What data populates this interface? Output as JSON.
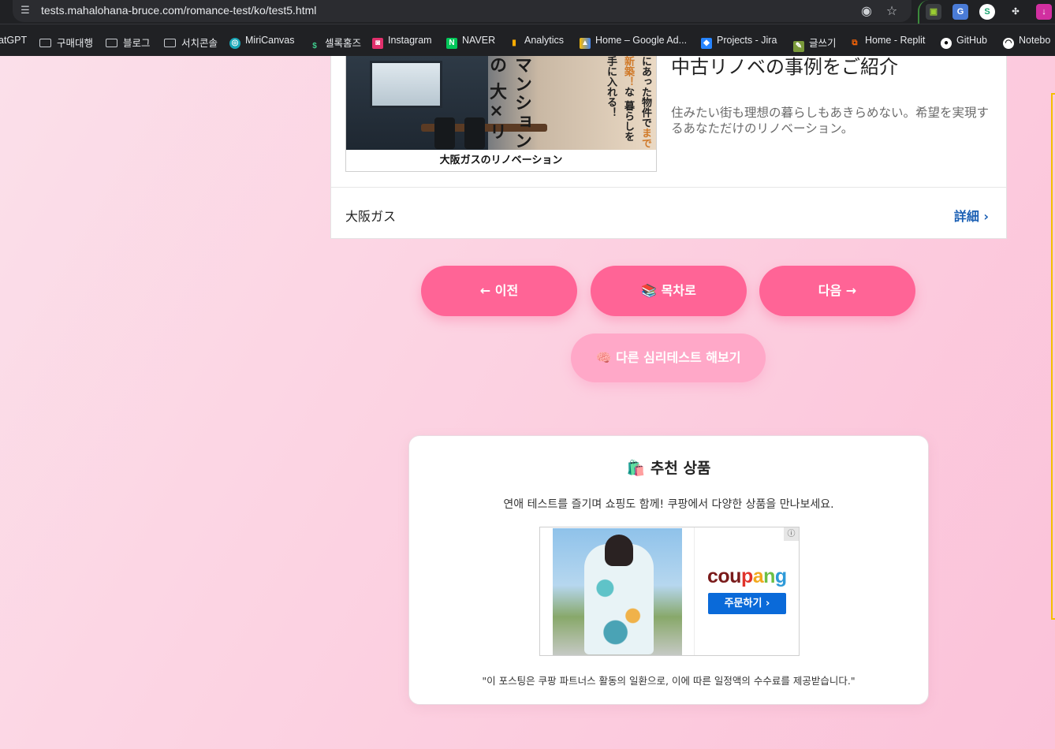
{
  "browser": {
    "url": "tests.mahalohana-bruce.com/romance-test/ko/test5.html",
    "bookmarks": [
      {
        "label": "atGPT",
        "icon": "none"
      },
      {
        "label": "구매대행",
        "icon": "folder-icon"
      },
      {
        "label": "블로그",
        "icon": "folder-icon"
      },
      {
        "label": "서치콘솔",
        "icon": "folder-icon"
      },
      {
        "label": "MiriCanvas",
        "icon": "miricanvas-icon"
      },
      {
        "label": "셀록홈즈",
        "icon": "sellockholmes-icon"
      },
      {
        "label": "Instagram",
        "icon": "instagram-icon"
      },
      {
        "label": "NAVER",
        "icon": "naver-icon"
      },
      {
        "label": "Analytics",
        "icon": "analytics-icon"
      },
      {
        "label": "Home – Google Ad...",
        "icon": "google-ads-icon"
      },
      {
        "label": "Projects - Jira",
        "icon": "jira-icon"
      },
      {
        "label": "글쓰기",
        "icon": "writing-icon"
      },
      {
        "label": "Home - Replit",
        "icon": "replit-icon"
      },
      {
        "label": "GitHub",
        "icon": "github-icon"
      },
      {
        "label": "Notebo",
        "icon": "notebook-icon"
      }
    ]
  },
  "ad": {
    "image_vertical_main": "マンションの 大×リノベ",
    "image_vertical_sub_1": "にあった物件で",
    "image_vertical_sub_highlight": "まで新築！",
    "image_vertical_sub_2": "な 暮らしを手に入れる！",
    "image_footer": "大阪ガスのリノベーション",
    "headline": "中古リノベの事例をご紹介",
    "description": "住みたい街も理想の暮らしもあきらめない。希望を実現するあなただけのリノベーション。",
    "advertiser": "大阪ガス",
    "details_label": "詳細"
  },
  "navigation": {
    "prev_label": "← 이전",
    "toc_label": "📚 목차로",
    "next_label": "다음 →",
    "other_tests_label": "🧠 다른 심리테스트 해보기"
  },
  "recommended": {
    "title": "🛍️ 추천 상품",
    "description": "연애 테스트를 즐기며 쇼핑도 함께! 쿠팡에서 다양한 상품을 만나보세요.",
    "brand_parts": [
      "cou",
      "p",
      "a",
      "n",
      "g"
    ],
    "order_button": "주문하기 ›",
    "info_icon": "ⓘ",
    "disclaimer": "\"이 포스팅은 쿠팡 파트너스 활동의 일환으로, 이에 따른 일정액의 수수료를 제공받습니다.\""
  },
  "colors": {
    "nav_button": "#ff6496",
    "other_button": "#ffa8c8",
    "link_blue": "#1a5fb4",
    "coupang_order": "#0a6ad9"
  }
}
